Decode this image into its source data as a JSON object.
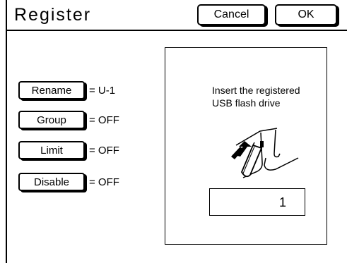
{
  "header": {
    "title": "Register",
    "cancel_label": "Cancel",
    "ok_label": "OK"
  },
  "settings": [
    {
      "label": "Rename",
      "value": "= U-1"
    },
    {
      "label": "Group",
      "value": "= OFF"
    },
    {
      "label": "Limit",
      "value": "= OFF"
    },
    {
      "label": "Disable",
      "value": "= OFF"
    }
  ],
  "panel": {
    "message_line1": "Insert the registered",
    "message_line2": "USB flash drive",
    "count": "1"
  },
  "icons": {
    "usb_insert": "usb-insert-illustration"
  }
}
